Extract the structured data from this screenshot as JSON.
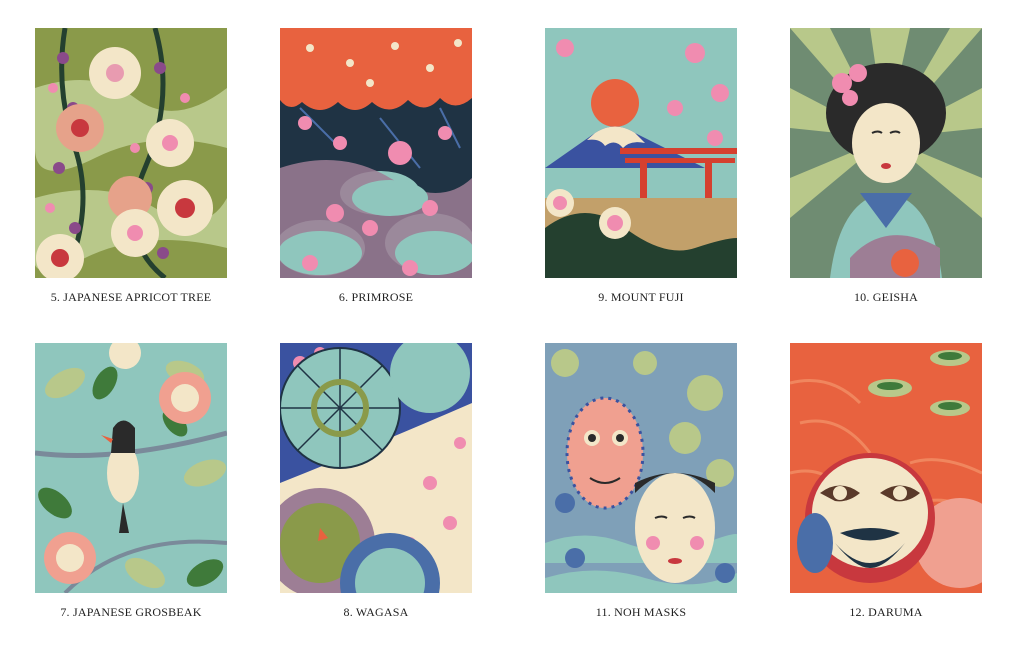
{
  "cards": [
    {
      "number": "5.",
      "title": "JAPANESE APRICOT TREE"
    },
    {
      "number": "6.",
      "title": "PRIMROSE"
    },
    {
      "number": "9.",
      "title": "MOUNT FUJI"
    },
    {
      "number": "10.",
      "title": "GEISHA"
    },
    {
      "number": "7.",
      "title": "JAPANESE GROSBEAK"
    },
    {
      "number": "8.",
      "title": "WAGASA"
    },
    {
      "number": "11.",
      "title": "NOH MASKS"
    },
    {
      "number": "12.",
      "title": "DARUMA"
    }
  ],
  "palette": {
    "olive": "#8a9a4a",
    "sage": "#b8c88a",
    "teal": "#8fc6bd",
    "coral": "#e8623f",
    "pink": "#f08cb0",
    "navy": "#1f3344",
    "cream": "#f3e6c8",
    "mauve": "#9d7e95"
  }
}
